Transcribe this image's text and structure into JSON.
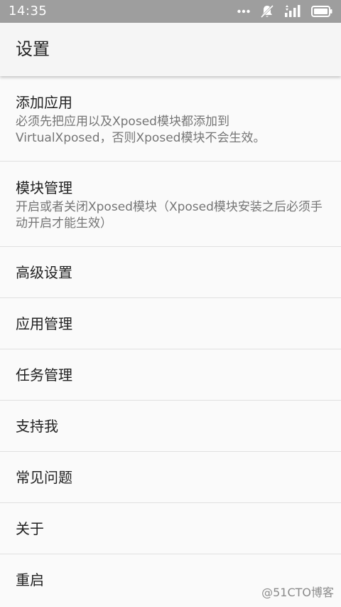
{
  "status_bar": {
    "time": "14:35",
    "icons": [
      "more-dots-icon",
      "notification-off-icon",
      "signal-icon",
      "battery-icon"
    ]
  },
  "app_bar": {
    "title": "设置"
  },
  "settings": {
    "items": [
      {
        "title": "添加应用",
        "summary": "必须先把应用以及Xposed模块都添加到VirtualXposed，否则Xposed模块不会生效。"
      },
      {
        "title": "模块管理",
        "summary": "开启或者关闭Xposed模块（Xposed模块安装之后必须手动开启才能生效）"
      },
      {
        "title": "高级设置"
      },
      {
        "title": "应用管理"
      },
      {
        "title": "任务管理"
      },
      {
        "title": "支持我"
      },
      {
        "title": "常见问题"
      },
      {
        "title": "关于"
      },
      {
        "title": "重启"
      }
    ]
  },
  "watermark": "@51CTO博客",
  "colors": {
    "status_bar": "#9e9e9e",
    "app_bar": "#f5f5f5",
    "background": "#fafafa",
    "title_text": "#212121",
    "summary_text": "#757575",
    "divider": "#e0e0e0"
  }
}
